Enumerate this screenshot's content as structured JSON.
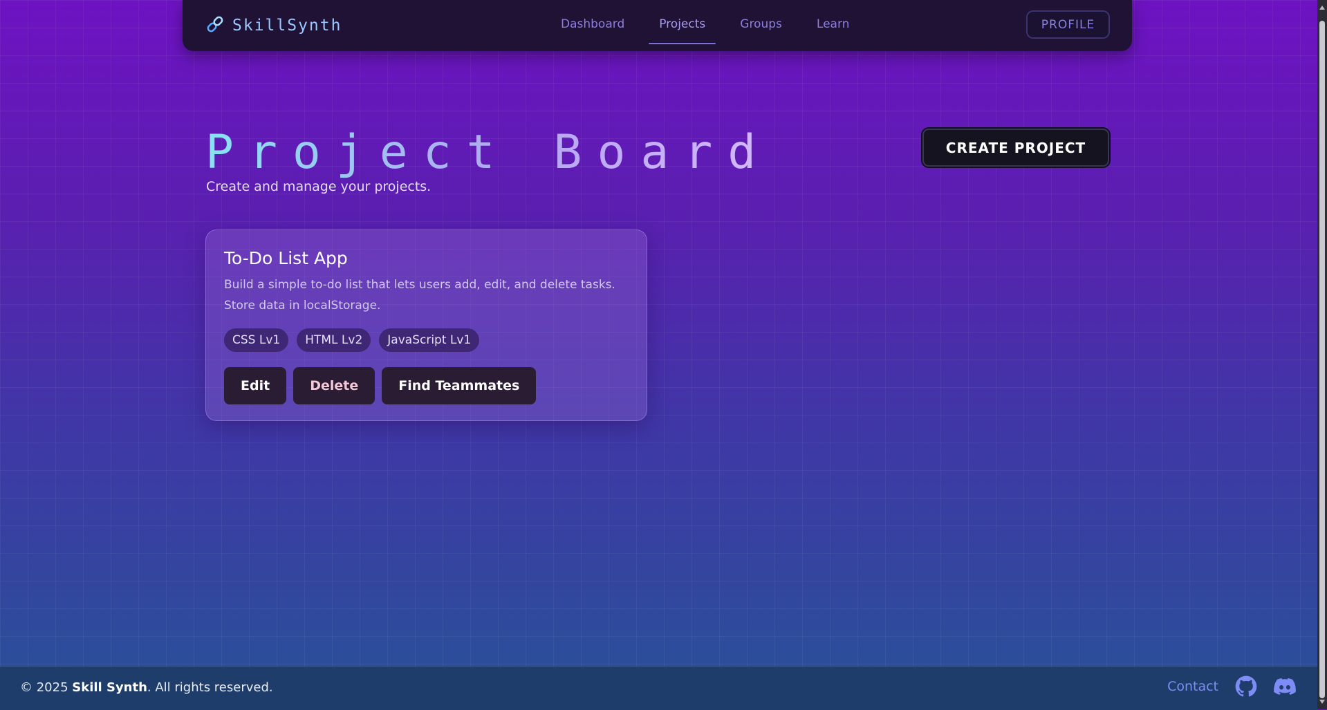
{
  "nav": {
    "brand": "SkillSynth",
    "links": [
      "Dashboard",
      "Projects",
      "Groups",
      "Learn"
    ],
    "active_link": "Projects",
    "profile_label": "PROFILE"
  },
  "header": {
    "title": "Project Board",
    "subtitle": "Create and manage your projects.",
    "create_label": "CREATE PROJECT"
  },
  "projects": [
    {
      "title": "To-Do List App",
      "description": "Build a simple to-do list that lets users add, edit, and delete tasks. Store data in localStorage.",
      "tags": [
        "CSS Lv1",
        "HTML Lv2",
        "JavaScript Lv1"
      ],
      "actions": {
        "edit": "Edit",
        "delete": "Delete",
        "find": "Find Teammates"
      }
    }
  ],
  "footer": {
    "copyright_prefix": "© 2025",
    "brand": "Skill Synth",
    "rights": ". All rights reserved.",
    "contact": "Contact",
    "icons": [
      "github-icon",
      "discord-icon"
    ]
  },
  "colors": {
    "accent": "#8b7fe2",
    "nav_background": "#1f1235",
    "card_tag": "#3f2776",
    "footer_background": "#1f3d6a"
  }
}
